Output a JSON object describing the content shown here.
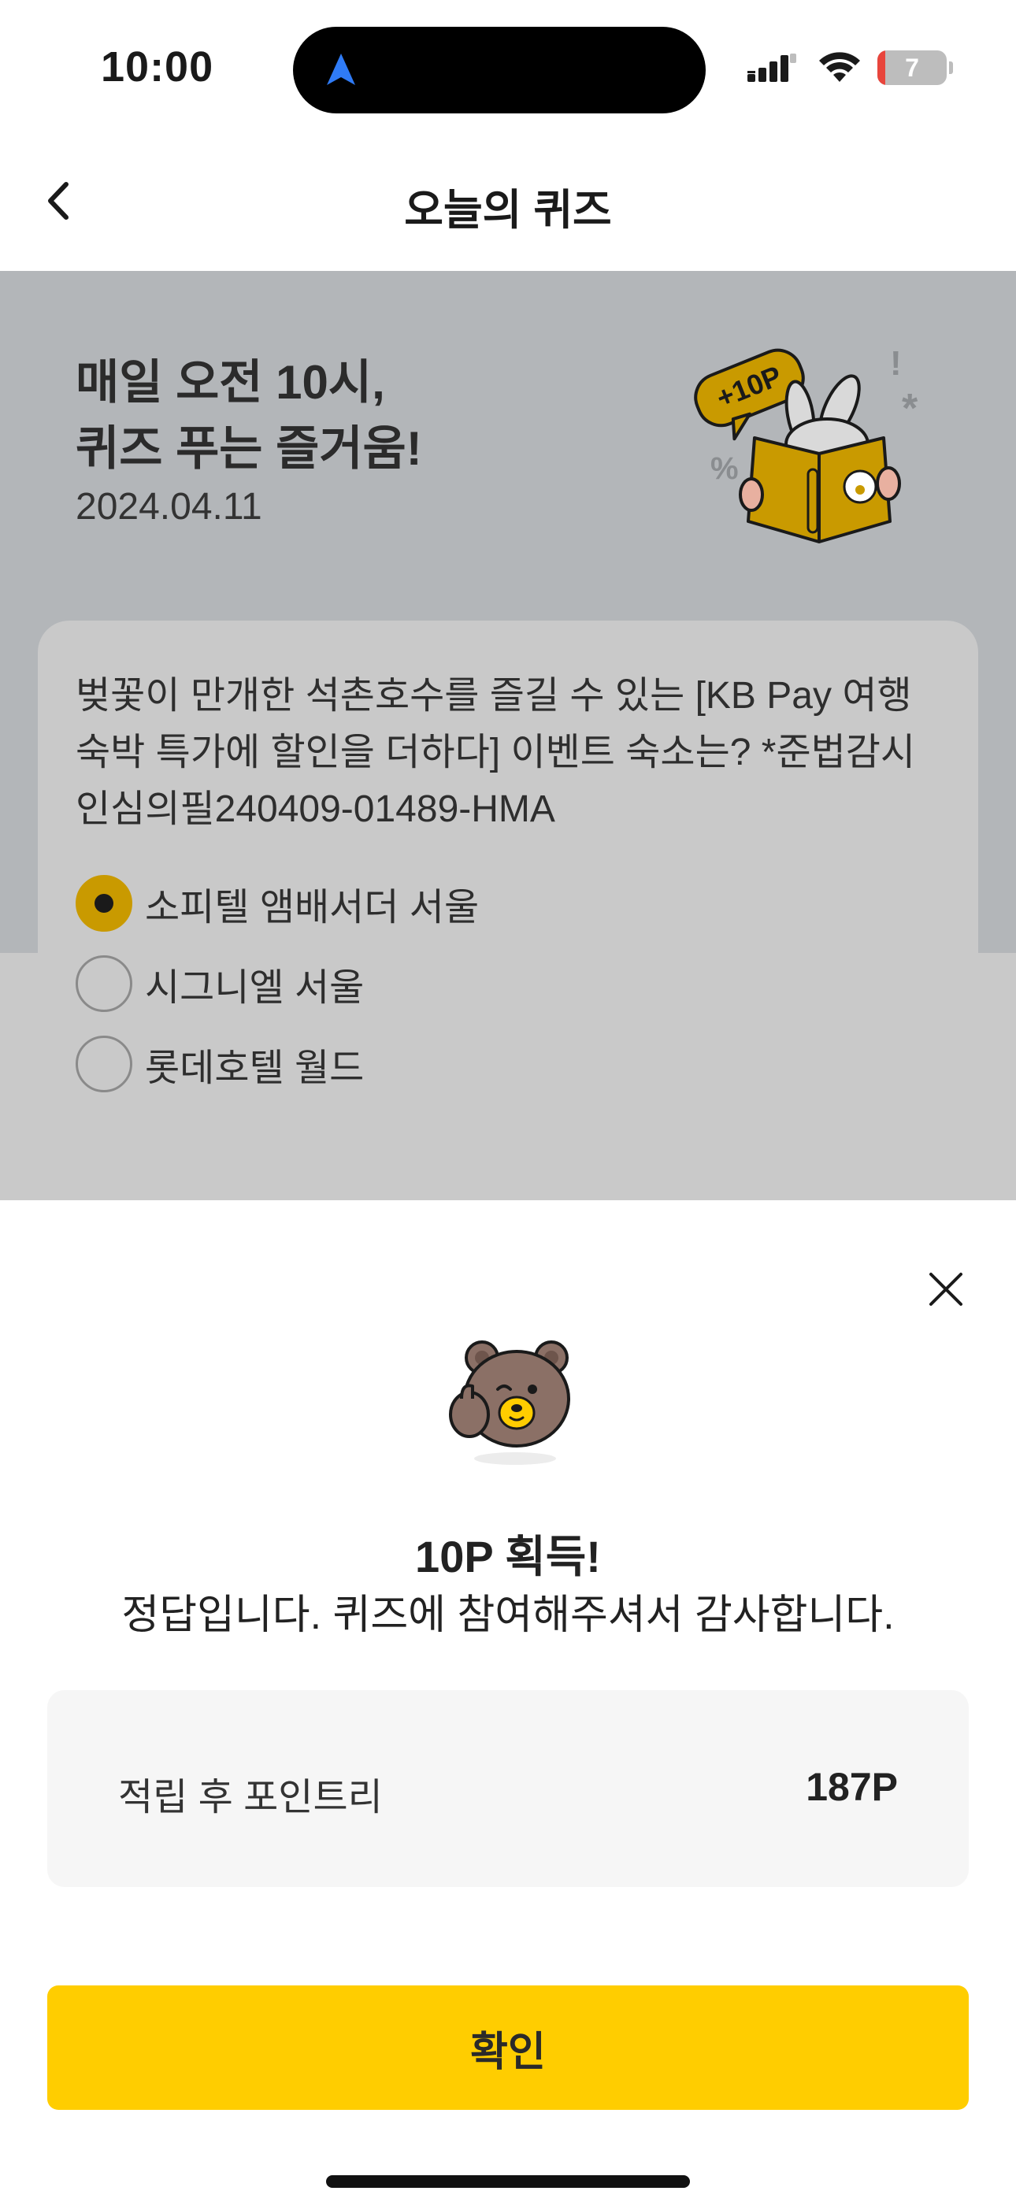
{
  "status_bar": {
    "time": "10:00",
    "battery_level": "7",
    "battery_fraction": 0.07,
    "icons": [
      "navigation-arrow-icon",
      "cellular-signal-icon",
      "wifi-icon",
      "battery-icon"
    ]
  },
  "header": {
    "title": "오늘의 퀴즈",
    "back_icon": "chevron-left-icon"
  },
  "banner": {
    "title_line1": "매일 오전 10시,",
    "title_line2": "퀴즈 푸는 즐거움!",
    "date": "2024.04.11",
    "badge": "+10P"
  },
  "quiz": {
    "question": "벚꽃이 만개한 석촌호수를 즐길 수 있는 [KB Pay 여행 숙박 특가에 할인을 더하다] 이벤트 숙소는? *준법감시인심의필240409-01489-HMA",
    "options": [
      {
        "label": "소피텔 앰배서더 서울",
        "selected": true
      },
      {
        "label": "시그니엘 서울",
        "selected": false
      },
      {
        "label": "롯데호텔 월드",
        "selected": false
      }
    ]
  },
  "result_sheet": {
    "title": "10P 획득!",
    "message": "정답입니다. 퀴즈에 참여해주셔서 감사합니다.",
    "points_label": "적립 후 포인트리",
    "points_value": "187P",
    "confirm_label": "확인",
    "close_icon": "close-icon"
  },
  "colors": {
    "accent_yellow": "#ffcd00",
    "selected_radio": "#c99a00",
    "dim_overlay": "#b3b6b9",
    "battery_low": "#e8453c"
  }
}
